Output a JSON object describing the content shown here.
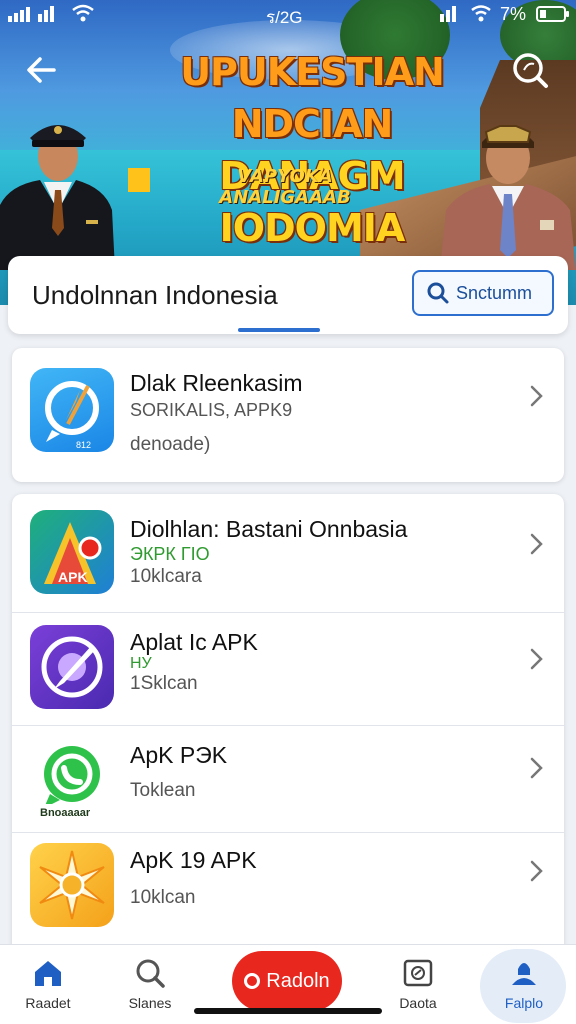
{
  "status_bar": {
    "time": "ร/2G",
    "battery": "7%"
  },
  "hero": {
    "title_line1": "UPUKESTIAN NDCIAN",
    "title_line2": "DANAGM IODOMIA",
    "subtitle": "VAPYOKA ANALIGAAAB"
  },
  "header": {
    "title": "Undolnnan Indonesia",
    "search_label": "Snctumm"
  },
  "featured": {
    "name": "Dlak Rleenkasim",
    "subtitle": "SORIKALIS, APPK9",
    "meta": "denoade)",
    "icon_badge": "812"
  },
  "apps": [
    {
      "name": "Diolhlan: Bastani Onnbasia",
      "subtitle": "ЭКРК ГIO",
      "meta": "10klcara",
      "icon": "apk-triangle-icon",
      "icon_text": "APK"
    },
    {
      "name": "Aplat Ic APK",
      "subtitle": "НУ",
      "meta": "1Sklcan",
      "icon": "purple-swirl-icon",
      "icon_text": ""
    },
    {
      "name": "ApK PЭK",
      "subtitle": "",
      "meta": "Toklean",
      "icon": "whatsapp-icon",
      "icon_text": "Bnoaaaar"
    },
    {
      "name": "ApK 19 APK",
      "subtitle": "",
      "meta": "10klcan",
      "icon": "sunburst-icon",
      "icon_text": ""
    }
  ],
  "nav": {
    "items": [
      "Raadet",
      "Slanes",
      "Daota",
      "Falplo"
    ],
    "fab_label": "Radoln"
  },
  "colors": {
    "accent": "#2d6fce",
    "fab": "#e8271f",
    "green": "#2f9a2f"
  }
}
